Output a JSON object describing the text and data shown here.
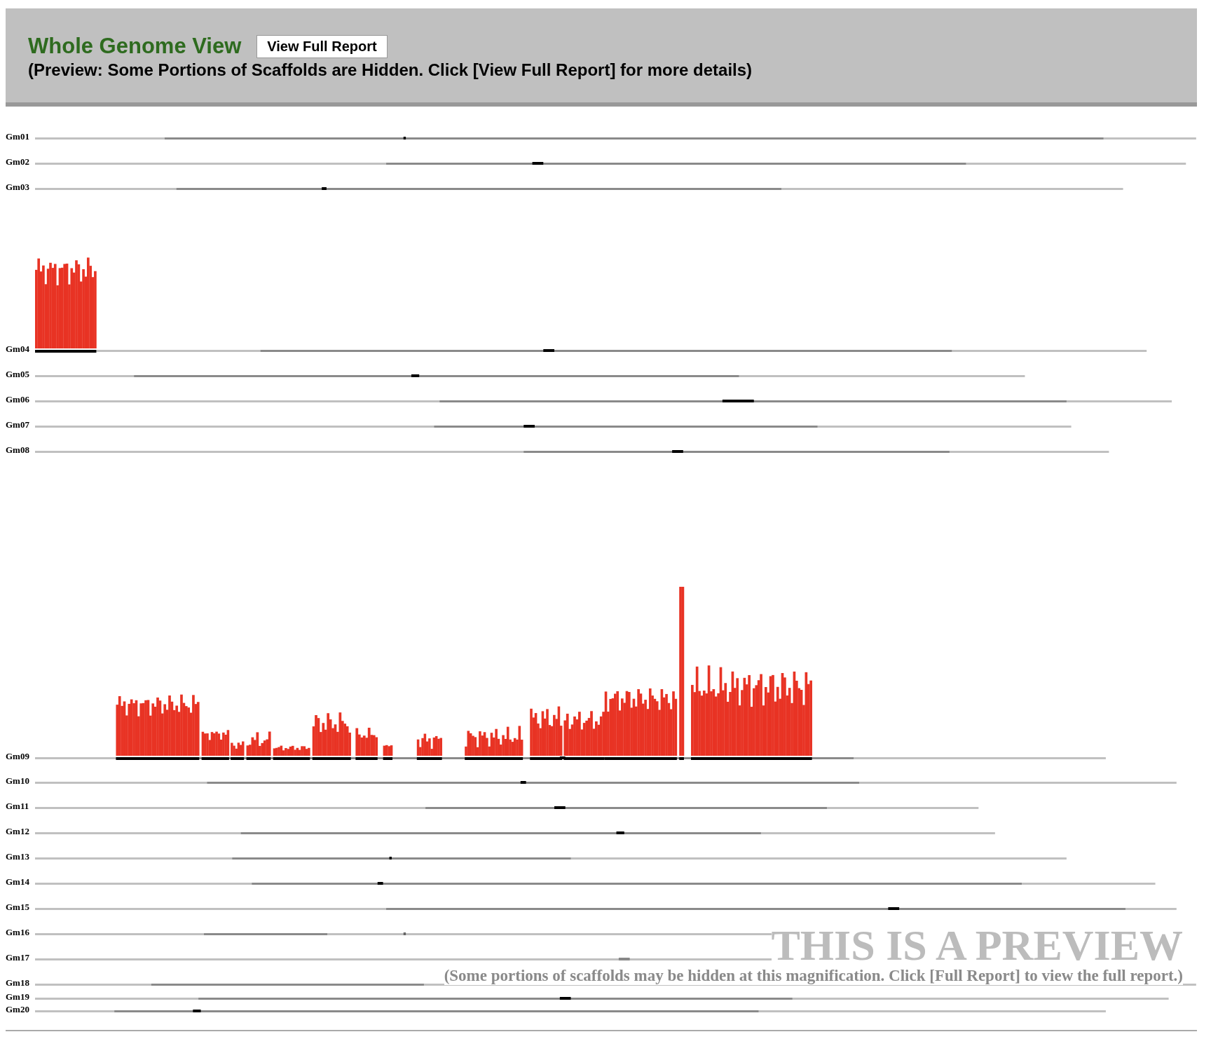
{
  "header": {
    "title": "Whole Genome View",
    "button": "View Full Report",
    "subtitle": "(Preview: Some Portions of Scaffolds are Hidden. Click [View Full Report] for more details)"
  },
  "chromosomes": [
    {
      "label": "Gm01"
    },
    {
      "label": "Gm02"
    },
    {
      "label": "Gm03"
    },
    {
      "label": "Gm04"
    },
    {
      "label": "Gm05"
    },
    {
      "label": "Gm06"
    },
    {
      "label": "Gm07"
    },
    {
      "label": "Gm08"
    },
    {
      "label": "Gm09"
    },
    {
      "label": "Gm10"
    },
    {
      "label": "Gm11"
    },
    {
      "label": "Gm12"
    },
    {
      "label": "Gm13"
    },
    {
      "label": "Gm14"
    },
    {
      "label": "Gm15"
    },
    {
      "label": "Gm16"
    },
    {
      "label": "Gm17"
    },
    {
      "label": "Gm18"
    },
    {
      "label": "Gm19"
    },
    {
      "label": "Gm20"
    }
  ],
  "preview_notice": {
    "heading": "THIS IS A PREVIEW",
    "note": "(Some portions of scaffolds may be hidden at this magnification. Click [Full Report] to view the full report.)"
  }
}
